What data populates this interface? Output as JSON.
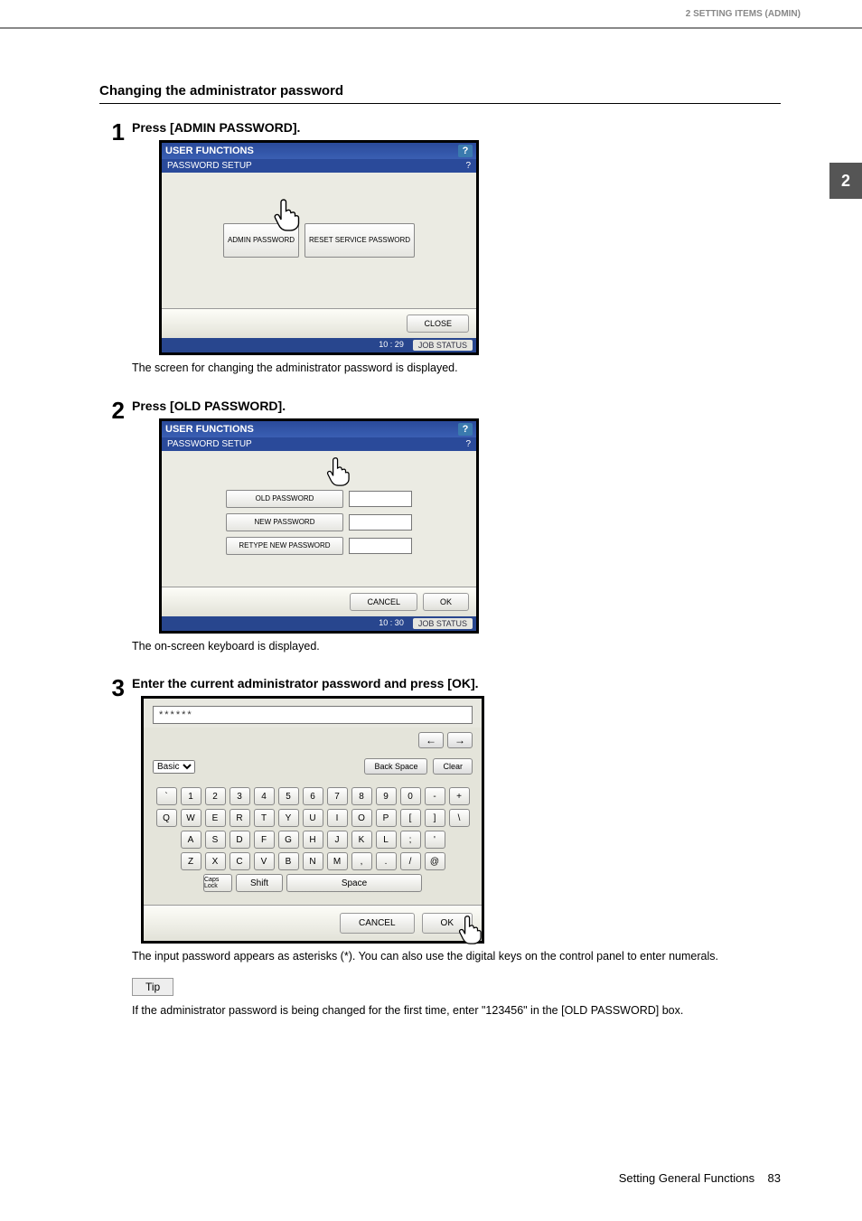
{
  "header": {
    "chapter": "2 SETTING ITEMS (ADMIN)"
  },
  "side_tab": "2",
  "section_title": "Changing the administrator password",
  "steps": [
    {
      "num": "1",
      "heading": "Press [ADMIN PASSWORD].",
      "after_text": "The screen for changing the administrator password is displayed."
    },
    {
      "num": "2",
      "heading": "Press [OLD PASSWORD].",
      "after_text": "The on-screen keyboard is displayed."
    },
    {
      "num": "3",
      "heading": "Enter the current administrator password and press [OK].",
      "after_text": "The input password appears as asterisks (*). You can also use the digital keys on the control panel to enter numerals."
    }
  ],
  "panel1": {
    "title": "USER FUNCTIONS",
    "subtitle": "PASSWORD SETUP",
    "help": "?",
    "buttons": {
      "admin": "ADMIN PASSWORD",
      "reset": "RESET SERVICE PASSWORD"
    },
    "close": "CLOSE",
    "time": "10 : 29",
    "jobstatus": "JOB STATUS"
  },
  "panel2": {
    "title": "USER FUNCTIONS",
    "subtitle": "PASSWORD SETUP",
    "help": "?",
    "fields": {
      "old": "OLD PASSWORD",
      "new": "NEW PASSWORD",
      "retype": "RETYPE NEW PASSWORD"
    },
    "cancel": "CANCEL",
    "ok": "OK",
    "time": "10 : 30",
    "jobstatus": "JOB STATUS"
  },
  "keyboard": {
    "input_value": "******",
    "mode": "Basic",
    "backspace": "Back Space",
    "clear": "Clear",
    "row1": [
      "`",
      "1",
      "2",
      "3",
      "4",
      "5",
      "6",
      "7",
      "8",
      "9",
      "0",
      "-",
      "+"
    ],
    "row2": [
      "Q",
      "W",
      "E",
      "R",
      "T",
      "Y",
      "U",
      "I",
      "O",
      "P",
      "[",
      "]",
      "\\"
    ],
    "row3": [
      "A",
      "S",
      "D",
      "F",
      "G",
      "H",
      "J",
      "K",
      "L",
      ";",
      "'"
    ],
    "row4": [
      "Z",
      "X",
      "C",
      "V",
      "B",
      "N",
      "M",
      ",",
      ".",
      "/",
      "@"
    ],
    "capslock": "Caps Lock",
    "shift": "Shift",
    "space": "Space",
    "cancel": "CANCEL",
    "ok": "OK"
  },
  "tip": {
    "label": "Tip",
    "text": "If the administrator password is being changed for the first time, enter \"123456\" in the [OLD PASSWORD] box."
  },
  "footer": {
    "section": "Setting General Functions",
    "page": "83"
  }
}
